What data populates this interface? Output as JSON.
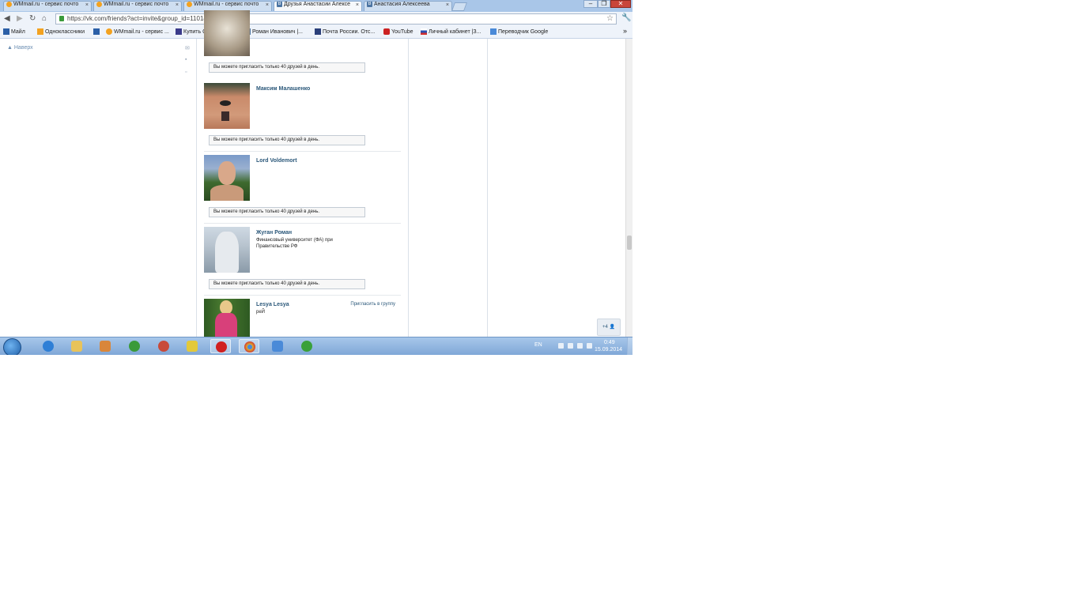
{
  "browser": {
    "tabs": [
      {
        "title": "WMmail.ru - сервис почто",
        "icon": "orange"
      },
      {
        "title": "WMmail.ru - сервис почто",
        "icon": "orange"
      },
      {
        "title": "WMmail.ru - сервис почто",
        "icon": "orange"
      },
      {
        "title": "Друзья Анастасии Алексе",
        "icon": "vk"
      },
      {
        "title": "Анастасия Алексеева",
        "icon": "vk"
      }
    ],
    "url": "https://vk.com/friends?act=invite&group_id=11014539",
    "bookmarks": [
      {
        "label": "Майл",
        "color": "#2b5fa7"
      },
      {
        "label": "Одноклассники",
        "color": "#f3a220"
      },
      {
        "label": "",
        "color": "#2b5fa7"
      },
      {
        "label": "WMmail.ru - сервис ...",
        "color": "#f3a220"
      },
      {
        "label": "Купить Сильн / PR...",
        "color": "#3b3b8a"
      },
      {
        "label": "Роман Иванович |...",
        "color": "#4c75a3"
      },
      {
        "label": "Почта России. Отс...",
        "color": "#2a3f7a"
      },
      {
        "label": "YouTube",
        "color": "#cc2222"
      },
      {
        "label": "Личный кабинет |З...",
        "color": "#d23030"
      },
      {
        "label": "Переводчик Google",
        "color": "#4a8ad8"
      }
    ],
    "window_controls": [
      "–",
      "❐",
      "✕"
    ]
  },
  "page": {
    "up_link": "Наверх",
    "friends": [
      {
        "name": "",
        "info": "",
        "note": "Вы можете пригласить только 40 друзей в день.",
        "photo": "leopard",
        "invite": ""
      },
      {
        "name": "Максим Малашенко",
        "info": "",
        "note": "Вы можете пригласить только 40 друзей в день.",
        "photo": "tattoo",
        "invite": ""
      },
      {
        "name": "Lord Voldemort",
        "info": "",
        "note": "Вы можете пригласить только 40 друзей в день.",
        "photo": "man",
        "invite": ""
      },
      {
        "name": "Жуган Роман",
        "info": "Финансовый университет (ФА) при Правительстве РФ",
        "note": "Вы можете пригласить только 40 друзей в день.",
        "photo": "statue",
        "invite": ""
      },
      {
        "name": "Lesya Lesya",
        "info": "peЙ",
        "note": "",
        "photo": "girl",
        "invite": "Пригласить в группу"
      }
    ],
    "chat_button": "+4"
  },
  "taskbar": {
    "apps": [
      {
        "name": "ie-icon",
        "color": "#2f7fd6",
        "active": false
      },
      {
        "name": "explorer-icon",
        "color": "#e8c35a",
        "active": false
      },
      {
        "name": "media-player-icon",
        "color": "#d9863a",
        "active": false
      },
      {
        "name": "utorrent-icon",
        "color": "#3a9a3a",
        "active": false
      },
      {
        "name": "cleaner-icon",
        "color": "#c84a3a",
        "active": false
      },
      {
        "name": "paint-icon",
        "color": "#e3c93a",
        "active": false
      },
      {
        "name": "opera-icon",
        "color": "#d02020",
        "active": true
      },
      {
        "name": "chrome-icon",
        "color": "#e0b030",
        "active": true
      },
      {
        "name": "network-icon",
        "color": "#4a8ad8",
        "active": false
      },
      {
        "name": "icq-icon",
        "color": "#3aa03a",
        "active": false
      }
    ],
    "language": "EN",
    "time": "0:49",
    "date": "15.09.2014"
  }
}
